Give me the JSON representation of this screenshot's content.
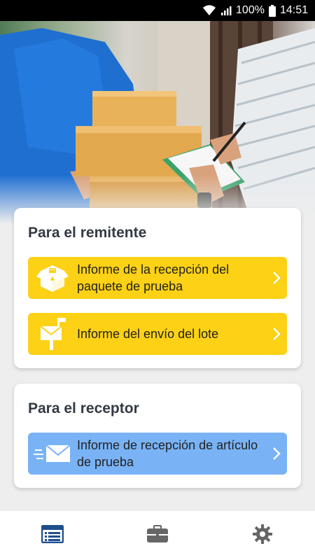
{
  "status_bar": {
    "battery": "100%",
    "time": "14:51",
    "icons": [
      "wifi-icon",
      "signal-icon",
      "battery-icon"
    ]
  },
  "hero": {
    "image": "courier-delivering-boxes-photo"
  },
  "sender_section": {
    "title": "Para el remitente",
    "actions": [
      {
        "label": "Informe de la recepción del paquete de prueba",
        "icon": "open-package-icon",
        "color": "#fcd116"
      },
      {
        "label": "Informe del envío del lote",
        "icon": "mailbox-icon",
        "color": "#fcd116"
      }
    ]
  },
  "receiver_section": {
    "title": "Para el receptor",
    "actions": [
      {
        "label": "Informe de recepción de artículo de prueba",
        "icon": "fast-mail-icon",
        "color": "#79b3f5"
      }
    ]
  },
  "bottom_nav": {
    "items": [
      {
        "icon": "list-icon",
        "active": true
      },
      {
        "icon": "briefcase-icon",
        "active": false
      },
      {
        "icon": "gear-icon",
        "active": false
      }
    ]
  }
}
